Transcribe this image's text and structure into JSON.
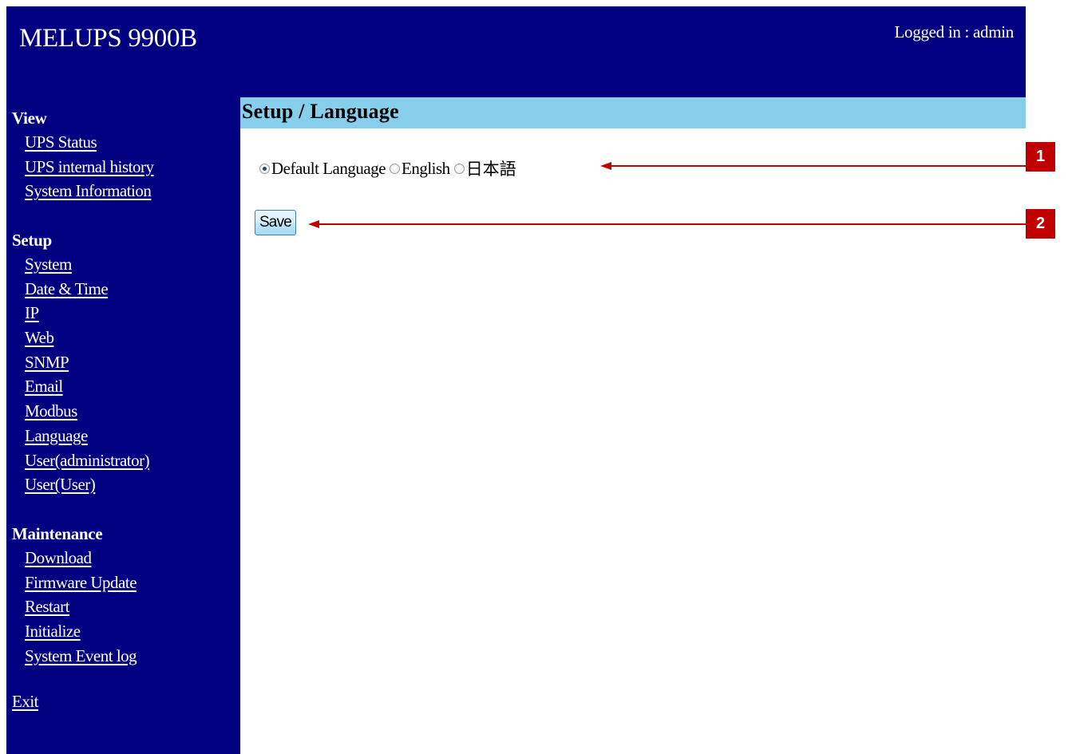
{
  "header": {
    "app_title": "MELUPS 9900B",
    "login_status": "Logged in : admin"
  },
  "sidebar": {
    "sections": [
      {
        "heading": "View",
        "items": [
          "UPS Status",
          "UPS internal history",
          "System Information"
        ]
      },
      {
        "heading": "Setup",
        "items": [
          "System",
          "Date & Time",
          "IP",
          "Web",
          "SNMP",
          "Email",
          "Modbus",
          "Language",
          "User(administrator)",
          "User(User)"
        ]
      },
      {
        "heading": "Maintenance",
        "items": [
          "Download",
          "Firmware Update",
          "Restart",
          "Initialize",
          "System Event log"
        ]
      }
    ],
    "exit_label": "Exit"
  },
  "main": {
    "title": "Setup / Language",
    "language_options": [
      {
        "label": "Default Language",
        "selected": true
      },
      {
        "label": "English",
        "selected": false
      },
      {
        "label": "日本語",
        "selected": false
      }
    ],
    "save_label": "Save"
  },
  "callouts": [
    {
      "number": "1"
    },
    {
      "number": "2"
    }
  ],
  "colors": {
    "nav_background": "#000080",
    "title_bar": "#87ceeb",
    "callout_red": "#c00000"
  }
}
